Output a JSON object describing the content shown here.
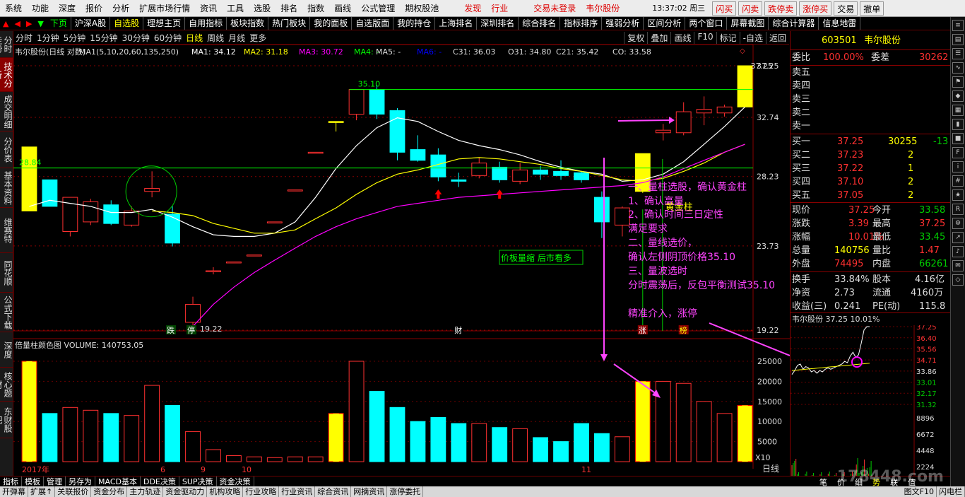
{
  "menubar": {
    "items": [
      "系统",
      "功能",
      "深度",
      "报价",
      "分析",
      "扩展市场行情",
      "资讯",
      "工具",
      "选股",
      "排名",
      "指数",
      "画线",
      "公式管理",
      "期权股池"
    ],
    "flash_label": "发现",
    "industry_label": "行业",
    "login_status": "交易未登录",
    "stock_name": "韦尔股份",
    "time": "13:37:02 周三",
    "quick_buttons": [
      "闪买",
      "闪卖",
      "跌停卖",
      "涨停买",
      "交易",
      "撤单"
    ]
  },
  "navbar": {
    "prev": "下页",
    "market": "沪深A股",
    "tabs": [
      "自选股",
      "理想主页",
      "自用指标",
      "板块指数",
      "热门板块",
      "我的面板",
      "自选版面",
      "我的持仓",
      "上海排名",
      "深圳排名",
      "综合排名",
      "指标排序",
      "强弱分析",
      "区间分析",
      "两个窗口",
      "屏幕截图",
      "综合计算器",
      "信息地雷"
    ],
    "active_tab": "自选股"
  },
  "periodbar": {
    "periods": [
      "分时",
      "1分钟",
      "5分钟",
      "15分钟",
      "30分钟",
      "60分钟",
      "日线",
      "周线",
      "月线",
      "更多"
    ],
    "active": "日线",
    "right": [
      "复权",
      "叠加",
      "画线",
      "F10",
      "标记",
      "-自选",
      "返回"
    ]
  },
  "leftnav": [
    "分时走势",
    "技术分析",
    "成交明细",
    "分价表",
    "基本资料",
    "维赛特10",
    "同花顺",
    "公式下载",
    "深度F9",
    "核心题材",
    "东财股吧"
  ],
  "leftnav_active": "技术分析",
  "chart_header": {
    "title": "韦尔股份(日线 对数)",
    "ma": "MA1(5,10,20,60,135,250)",
    "ma1": "MA1: 34.12",
    "ma2": "MA2: 31.18",
    "ma3": "MA3: 30.72",
    "ma4": "MA4: -",
    "ma5": "MA5: -",
    "ma6": "MA6: -",
    "c31": "C31: 36.03",
    "o31": "O31: 34.80",
    "c21": "C21: 35.42",
    "co": "CO: 33.58"
  },
  "colors": {
    "up": "#ff3030",
    "down": "#00ffff",
    "ma1": "#ffffff",
    "ma2": "#ffff00",
    "ma3": "#ff00ff",
    "ann": "#ff44ff",
    "hline": "#00ff00"
  },
  "annotations": {
    "hl_left": "28.84",
    "hl_right": "35.10",
    "price_high": "37.25",
    "price_low": "19.22",
    "vol_box": "价板量缩 后市看多",
    "golden": "黄金柱",
    "notes": [
      "一、量柱选股，确认黄金柱",
      "1、确认高量",
      "2、确认时间三日定性",
      "满足要求",
      "二、量线选价，",
      "确认左侧阴顶价格35.10",
      "三、量波选时",
      "分时震荡后，反包平衡测试35.10",
      "精准介入，涨停"
    ],
    "marks": {
      "die": "跌",
      "ting": "停",
      "cai": "财",
      "zhang": "涨",
      "bang": "榜"
    },
    "year": "2017年",
    "month_6": "6",
    "month_9": "9",
    "month_10": "10",
    "month_11": "11",
    "scale": "X10",
    "period_label": "日线"
  },
  "yaxis": [
    "37.25",
    "32.74",
    "28.23",
    "23.73",
    "19.22"
  ],
  "vol_header": "倍量柱颜色图 VOLUME: 140753.05",
  "vol_axis": [
    "25000",
    "20000",
    "15000",
    "10000",
    "5000"
  ],
  "chart_data": {
    "type": "candlestick",
    "title": "韦尔股份(日线 对数)",
    "price_range": [
      19.22,
      37.25
    ],
    "volume_range": [
      0,
      25000
    ],
    "candles": [
      {
        "o": 25.9,
        "c": 30.4,
        "h": 30.4,
        "l": 25.9,
        "v": 25000
      },
      {
        "o": 28.0,
        "c": 26.2,
        "h": 28.0,
        "l": 26.2,
        "v": 12000
      },
      {
        "o": 24.6,
        "c": 26.8,
        "h": 26.8,
        "l": 24.3,
        "v": 13500
      },
      {
        "o": 25.2,
        "c": 26.5,
        "h": 26.7,
        "l": 25.0,
        "v": 12800
      },
      {
        "o": 26.3,
        "c": 25.1,
        "h": 26.6,
        "l": 25.0,
        "v": 12000
      },
      {
        "o": 25.0,
        "c": 25.9,
        "h": 26.2,
        "l": 24.9,
        "v": 11500
      },
      {
        "o": 27.2,
        "c": 27.4,
        "h": 28.6,
        "l": 26.8,
        "v": 19000
      },
      {
        "o": 25.7,
        "c": 23.9,
        "h": 26.2,
        "l": 23.7,
        "v": 14000
      },
      {
        "o": 19.6,
        "c": 20.5,
        "h": 20.9,
        "l": 19.22,
        "v": 7500
      },
      {
        "o": 22.3,
        "c": 22.3,
        "h": 22.5,
        "l": 22.1,
        "v": 3000
      },
      {
        "o": 22.8,
        "c": 22.8,
        "h": 22.8,
        "l": 22.8,
        "v": 1500
      },
      {
        "o": 23.2,
        "c": 23.2,
        "h": 23.2,
        "l": 23.2,
        "v": 1200
      },
      {
        "o": 25.2,
        "c": 25.2,
        "h": 25.2,
        "l": 25.2,
        "v": 1000
      },
      {
        "o": 27.3,
        "c": 27.3,
        "h": 27.3,
        "l": 27.3,
        "v": 1200
      },
      {
        "o": 30.0,
        "c": 30.0,
        "h": 30.0,
        "l": 30.0,
        "v": 1200
      },
      {
        "o": 32.4,
        "c": 32.4,
        "h": 32.4,
        "l": 31.6,
        "v": 12000
      },
      {
        "o": 33.0,
        "c": 35.1,
        "h": 35.1,
        "l": 32.5,
        "v": 25000
      },
      {
        "o": 35.1,
        "c": 33.0,
        "h": 35.5,
        "l": 32.6,
        "v": 17500
      },
      {
        "o": 33.3,
        "c": 30.0,
        "h": 33.5,
        "l": 29.4,
        "v": 13500
      },
      {
        "o": 30.2,
        "c": 29.4,
        "h": 31.3,
        "l": 29.3,
        "v": 10000
      },
      {
        "o": 29.8,
        "c": 28.2,
        "h": 30.3,
        "l": 27.9,
        "v": 11000
      },
      {
        "o": 28.0,
        "c": 27.9,
        "h": 28.5,
        "l": 27.5,
        "v": 9500
      },
      {
        "o": 28.3,
        "c": 29.2,
        "h": 29.6,
        "l": 28.1,
        "v": 9500
      },
      {
        "o": 28.9,
        "c": 28.0,
        "h": 29.3,
        "l": 27.8,
        "v": 8500
      },
      {
        "o": 27.9,
        "c": 28.7,
        "h": 29.2,
        "l": 27.7,
        "v": 8200
      },
      {
        "o": 28.7,
        "c": 28.4,
        "h": 29.0,
        "l": 28.0,
        "v": 6000
      },
      {
        "o": 28.6,
        "c": 28.3,
        "h": 29.4,
        "l": 28.0,
        "v": 5000
      },
      {
        "o": 28.5,
        "c": 28.0,
        "h": 28.6,
        "l": 27.8,
        "v": 9500
      },
      {
        "o": 26.8,
        "c": 25.2,
        "h": 27.2,
        "l": 24.2,
        "v": 7000
      },
      {
        "o": 25.0,
        "c": 26.1,
        "h": 26.2,
        "l": 24.3,
        "v": 6200
      },
      {
        "o": 27.2,
        "c": 29.9,
        "h": 29.9,
        "l": 27.1,
        "v": 20000
      },
      {
        "o": 31.5,
        "c": 31.7,
        "h": 32.2,
        "l": 30.9,
        "v": 20000
      },
      {
        "o": 31.5,
        "c": 33.2,
        "h": 34.0,
        "l": 31.3,
        "v": 19500
      },
      {
        "o": 33.1,
        "c": 33.4,
        "h": 34.5,
        "l": 32.1,
        "v": 15000
      },
      {
        "o": 33.1,
        "c": 33.6,
        "h": 33.8,
        "l": 32.8,
        "v": 12000
      },
      {
        "o": 33.6,
        "c": 37.25,
        "h": 37.25,
        "l": 33.6,
        "v": 14000
      }
    ],
    "yellow_bars": [
      0,
      15,
      30,
      35
    ],
    "ma_lines": [
      {
        "name": "MA1",
        "values": [
          26.2,
          26.6,
          26.4,
          26.2,
          25.8,
          25.8,
          26.0,
          25.5,
          24.9,
          24.4,
          24.3,
          24.3,
          24.5,
          25.2,
          26.8,
          28.8,
          30.5,
          31.9,
          32.7,
          32.4,
          31.6,
          30.9,
          30.5,
          30.2,
          29.8,
          29.3,
          28.9,
          28.6,
          28.4,
          27.9,
          28.0,
          28.4,
          29.3,
          30.6,
          32.0,
          33.6
        ]
      },
      {
        "name": "MA2",
        "values": [
          null,
          null,
          null,
          null,
          null,
          null,
          25.9,
          25.8,
          25.6,
          25.1,
          24.8,
          24.5,
          24.5,
          24.7,
          25.4,
          26.1,
          27.0,
          27.8,
          28.4,
          28.7,
          29.1,
          29.5,
          29.6,
          29.5,
          29.3,
          29.1,
          28.8,
          28.6,
          28.3,
          28.0,
          27.9,
          28.1,
          28.6,
          29.2,
          30.0,
          30.6
        ]
      },
      {
        "name": "MA3",
        "values": [
          null,
          null,
          null,
          null,
          null,
          null,
          null,
          null,
          19.4,
          20.5,
          21.4,
          22.2,
          22.9,
          23.6,
          24.3,
          24.9,
          25.4,
          25.8,
          26.2,
          26.4,
          26.6,
          26.8,
          26.9,
          27.0,
          27.1,
          27.2,
          27.3,
          27.4,
          27.5,
          27.6,
          27.8,
          28.2,
          28.8,
          29.4,
          30.0,
          30.6
        ]
      }
    ]
  },
  "quote": {
    "code": "603501",
    "name": "韦尔股份",
    "weibi_label": "委比",
    "weibi": "100.00%",
    "weicha_label": "委差",
    "weicha": "30262",
    "sell": [
      {
        "l": "卖五",
        "p": "",
        "v": ""
      },
      {
        "l": "卖四",
        "p": "",
        "v": ""
      },
      {
        "l": "卖三",
        "p": "",
        "v": ""
      },
      {
        "l": "卖二",
        "p": "",
        "v": ""
      },
      {
        "l": "卖一",
        "p": "",
        "v": ""
      }
    ],
    "buy": [
      {
        "l": "买一",
        "p": "37.25",
        "v": "30255",
        "d": "-13"
      },
      {
        "l": "买二",
        "p": "37.23",
        "v": "2",
        "d": ""
      },
      {
        "l": "买三",
        "p": "37.22",
        "v": "1",
        "d": ""
      },
      {
        "l": "买四",
        "p": "37.10",
        "v": "2",
        "d": ""
      },
      {
        "l": "买五",
        "p": "37.05",
        "v": "2",
        "d": ""
      }
    ],
    "stats": [
      {
        "l1": "现价",
        "v1": "37.25",
        "c1": "r",
        "l2": "今开",
        "v2": "33.58",
        "c2": "g"
      },
      {
        "l1": "涨跌",
        "v1": "3.39",
        "c1": "r",
        "l2": "最高",
        "v2": "37.25",
        "c2": "r"
      },
      {
        "l1": "涨幅",
        "v1": "10.01%",
        "c1": "r",
        "l2": "最低",
        "v2": "33.45",
        "c2": "g"
      },
      {
        "l1": "总量",
        "v1": "140756",
        "c1": "y",
        "l2": "量比",
        "v2": "1.47",
        "c2": "r"
      },
      {
        "l1": "外盘",
        "v1": "74495",
        "c1": "r",
        "l2": "内盘",
        "v2": "66261",
        "c2": "g"
      },
      {
        "l1": "换手",
        "v1": "33.84%",
        "c1": "w",
        "l2": "股本",
        "v2": "4.16亿",
        "c2": "w"
      },
      {
        "l1": "净资",
        "v1": "2.73",
        "c1": "w",
        "l2": "流通",
        "v2": "4160万",
        "c2": "w"
      },
      {
        "l1": "收益(三)",
        "v1": "0.241",
        "c1": "w",
        "l2": "PE(动)",
        "v2": "115.8",
        "c2": "w"
      }
    ],
    "mini_header": "韦尔股份 37.25 10.01%",
    "mini_axis": [
      "37.25",
      "36.40",
      "35.56",
      "34.71",
      "33.86",
      "33.01",
      "32.17",
      "31.32"
    ],
    "mini_vol_axis": [
      "8896",
      "6672",
      "4448",
      "2224"
    ],
    "mini_line": [
      33.6,
      33.9,
      34.3,
      34.4,
      34.0,
      34.2,
      34.1,
      33.8,
      33.9,
      33.7,
      33.9,
      33.8,
      34.0,
      34.1,
      34.0,
      34.1,
      34.2,
      34.3,
      34.4,
      34.6,
      34.5,
      35.0,
      35.3,
      34.9,
      35.1,
      36.0,
      37.0,
      37.25,
      37.25
    ]
  },
  "bottom": {
    "tabs1": [
      "指标",
      "模板",
      "管理",
      "另存为",
      "MACD基本",
      "DDE决策",
      "SUP决策",
      "资金决策"
    ],
    "tabs2": [
      "开弹幕",
      "扩展↑",
      "关联报价",
      "资金分布",
      "主力轨迹",
      "资金驱动力",
      "机构攻略",
      "行业攻略",
      "行业资讯",
      "综合资讯",
      "网摘资讯",
      "涨停委托"
    ],
    "right2": [
      "图文F10",
      "闪电栏"
    ],
    "side_tabs": [
      "笔",
      "价",
      "细",
      "势",
      "联",
      "值"
    ],
    "watermark": "178448.com"
  }
}
